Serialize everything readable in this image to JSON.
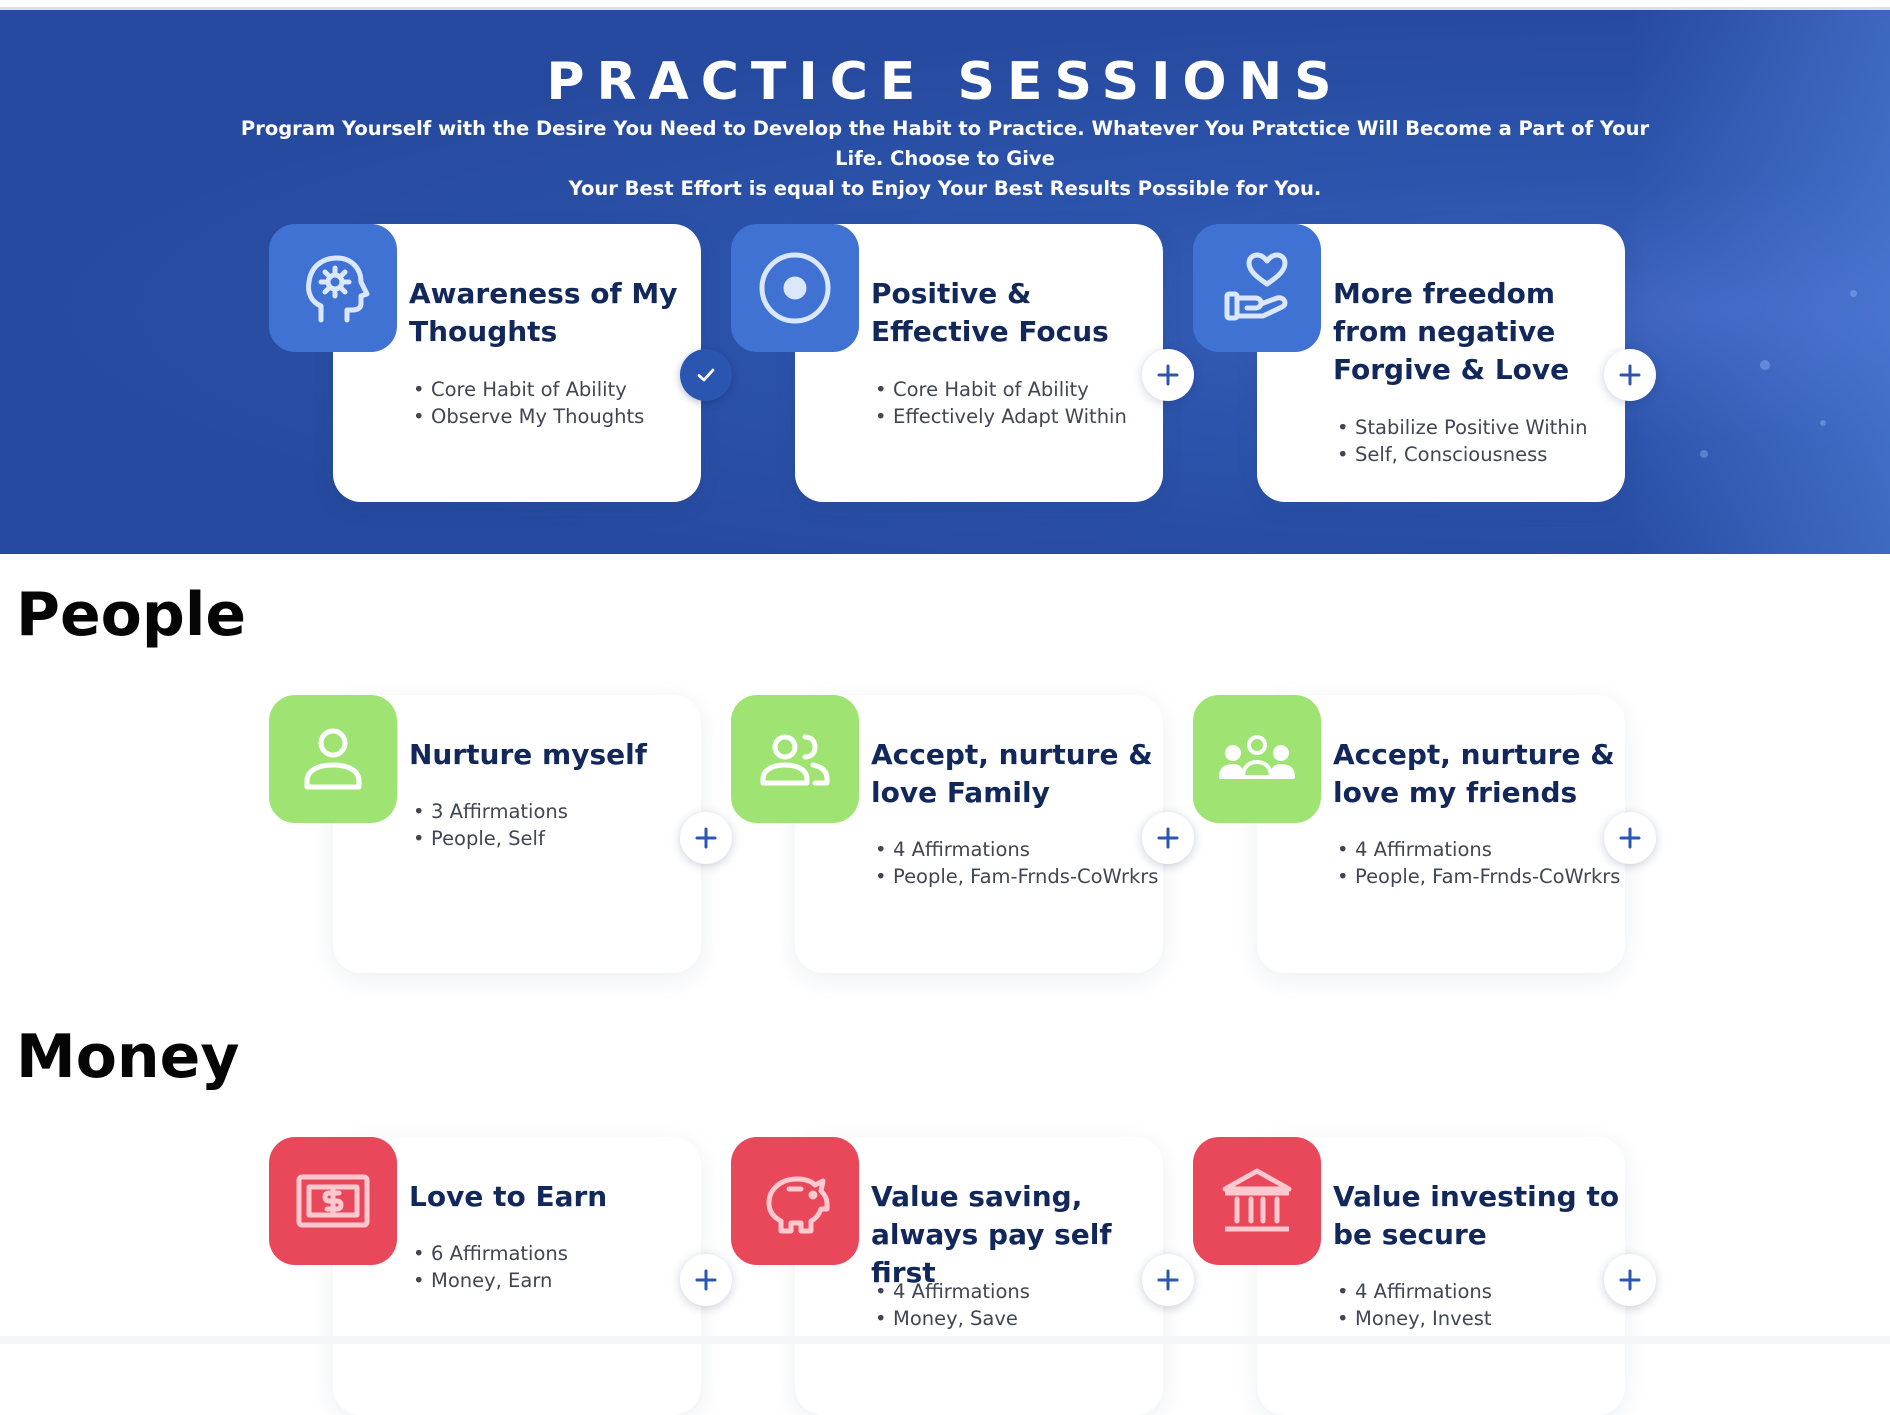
{
  "hero": {
    "title": "PRACTICE SESSIONS",
    "subtitle_line1": "Program Yourself with the Desire You Need to Develop the Habit to Practice. Whatever You Pratctice Will Become a Part of Your Life. Choose to Give",
    "subtitle_line2": "Your Best Effort is equal to Enjoy Your Best Results Possible for You."
  },
  "colors": {
    "hero_bg": "#2d55ad",
    "title_navy": "#12285a",
    "tile_blue": "#3f72d2",
    "tile_green": "#9fe472",
    "tile_red": "#e9485a",
    "accent_blue": "#2a55b0"
  },
  "practice_cards": [
    {
      "icon": "head-gear-icon",
      "title": "Awareness of My Thoughts",
      "bullets": [
        "Core Habit of Ability",
        "Observe My Thoughts"
      ],
      "status": "added"
    },
    {
      "icon": "target-circle-icon",
      "title": "Positive & Effective Focus",
      "bullets": [
        "Core Habit of Ability",
        "Effectively Adapt Within"
      ],
      "status": "add"
    },
    {
      "icon": "hand-heart-icon",
      "title": "More freedom from negative Forgive & Love",
      "bullets": [
        "Stabilize Positive Within",
        "Self, Consciousness"
      ],
      "status": "add"
    }
  ],
  "sections": {
    "people": {
      "title": "People",
      "cards": [
        {
          "icon": "person-icon",
          "title": "Nurture myself",
          "bullets": [
            "3 Affirmations",
            "People, Self"
          ],
          "status": "add"
        },
        {
          "icon": "two-people-icon",
          "title": "Accept, nurture & love Family",
          "bullets": [
            "4 Affirmations",
            "People, Fam-Frnds-CoWrkrs"
          ],
          "status": "add"
        },
        {
          "icon": "group-icon",
          "title": "Accept, nurture & love my friends",
          "bullets": [
            "4 Affirmations",
            "People, Fam-Frnds-CoWrkrs"
          ],
          "status": "add"
        }
      ]
    },
    "money": {
      "title": "Money",
      "cards": [
        {
          "icon": "dollar-bill-icon",
          "title": "Love to Earn",
          "bullets": [
            "6 Affirmations",
            "Money, Earn"
          ],
          "status": "add"
        },
        {
          "icon": "piggy-bank-icon",
          "title": "Value saving, always pay self first",
          "bullets": [
            "4 Affirmations",
            "Money, Save"
          ],
          "status": "add"
        },
        {
          "icon": "bank-building-icon",
          "title": "Value investing to be secure",
          "bullets": [
            "4 Affirmations",
            "Money, Invest"
          ],
          "status": "add"
        }
      ]
    }
  }
}
